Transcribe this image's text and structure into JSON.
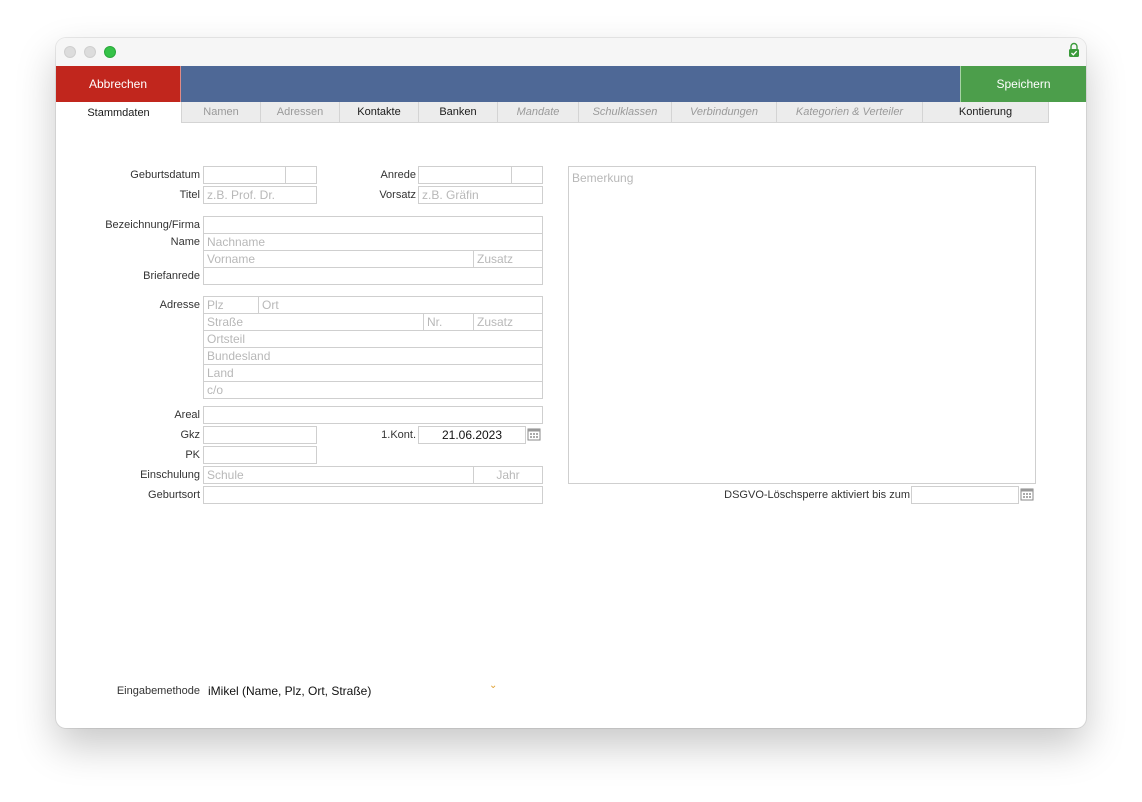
{
  "toolbar": {
    "cancel_label": "Abbrechen",
    "save_label": "Speichern"
  },
  "tabs": [
    {
      "label": "Stammdaten",
      "state": "active"
    },
    {
      "label": "Namen",
      "state": "disabled"
    },
    {
      "label": "Adressen",
      "state": "disabled"
    },
    {
      "label": "Kontakte",
      "state": "normal"
    },
    {
      "label": "Banken",
      "state": "normal"
    },
    {
      "label": "Mandate",
      "state": "disabled-italic"
    },
    {
      "label": "Schulklassen",
      "state": "disabled-italic"
    },
    {
      "label": "Verbindungen",
      "state": "disabled-italic"
    },
    {
      "label": "Kategorien & Verteiler",
      "state": "disabled-italic"
    },
    {
      "label": "Kontierung",
      "state": "normal"
    }
  ],
  "form": {
    "labels": {
      "birthdate": "Geburtsdatum",
      "title": "Titel",
      "salutation": "Anrede",
      "prefix": "Vorsatz",
      "company": "Bezeichnung/Firma",
      "name": "Name",
      "letter_salutation": "Briefanrede",
      "address": "Adresse",
      "area": "Areal",
      "gkz": "Gkz",
      "first_contact": "1.Kont.",
      "pk": "PK",
      "enrollment": "Einschulung",
      "birthplace": "Geburtsort",
      "gdpr_lock": "DSGVO-Löschsperre aktiviert bis zum",
      "input_method": "Eingabemethode"
    },
    "placeholders": {
      "title": "z.B. Prof. Dr.",
      "prefix": "z.B. Gräfin",
      "lastname": "Nachname",
      "firstname": "Vorname",
      "name_suffix": "Zusatz",
      "zip": "Plz",
      "city": "Ort",
      "street": "Straße",
      "house_no": "Nr.",
      "street_suffix": "Zusatz",
      "district": "Ortsteil",
      "state": "Bundesland",
      "country": "Land",
      "care_of": "c/o",
      "school": "Schule",
      "year": "Jahr",
      "remark": "Bemerkung"
    },
    "values": {
      "first_contact": "21.06.2023",
      "input_method": "iMikel (Name, Plz, Ort, Straße)"
    }
  },
  "icons": {
    "lock": "lock-check-icon",
    "calendar": "calendar-icon",
    "chevron": "chevron-down-icon"
  },
  "colors": {
    "cancel": "#c1261d",
    "save": "#4c9e4b",
    "toolbar": "#4e6896"
  }
}
